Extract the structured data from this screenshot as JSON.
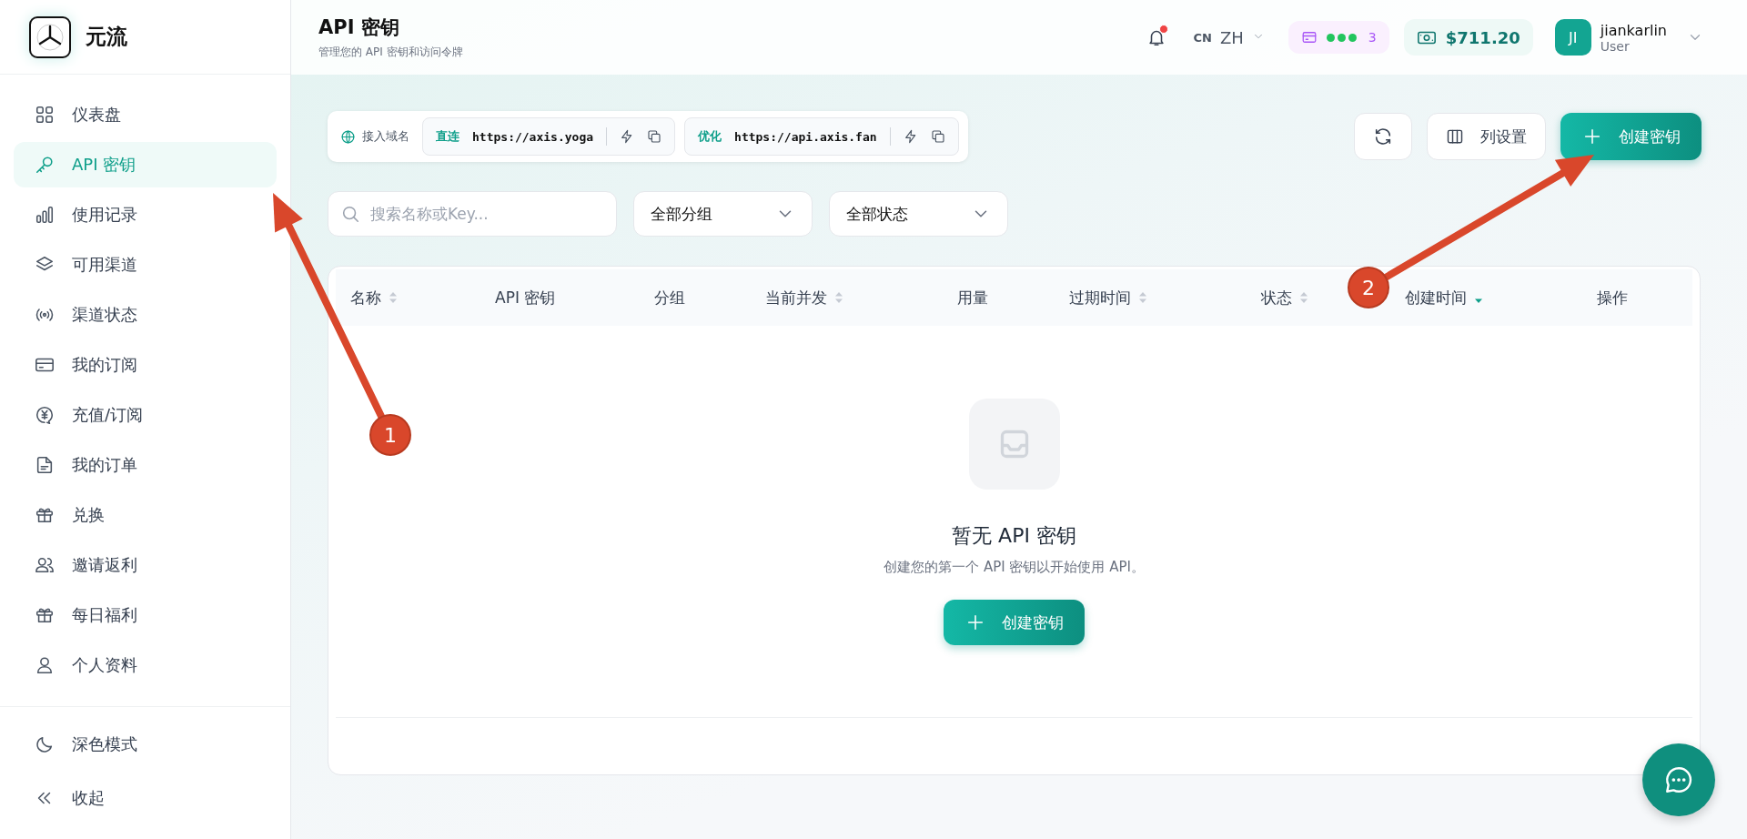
{
  "sidebar": {
    "brand": "元流",
    "items": [
      {
        "label": "仪表盘",
        "selected": false
      },
      {
        "label": "API 密钥",
        "selected": true
      },
      {
        "label": "使用记录",
        "selected": false
      },
      {
        "label": "可用渠道",
        "selected": false
      },
      {
        "label": "渠道状态",
        "selected": false
      },
      {
        "label": "我的订阅",
        "selected": false
      },
      {
        "label": "充值/订阅",
        "selected": false
      },
      {
        "label": "我的订单",
        "selected": false
      },
      {
        "label": "兑换",
        "selected": false
      },
      {
        "label": "邀请返利",
        "selected": false
      },
      {
        "label": "每日福利",
        "selected": false
      },
      {
        "label": "个人资料",
        "selected": false
      }
    ],
    "footer_items": [
      {
        "label": "深色模式"
      },
      {
        "label": "收起"
      }
    ]
  },
  "header": {
    "title": "API 密钥",
    "subtitle": "管理您的 API 密钥和访问令牌",
    "notification_unread": true,
    "language_code": "CN",
    "language": "ZH",
    "plan_count": "3",
    "balance": "$711.20",
    "user": {
      "initials": "JI",
      "name": "jiankarlin",
      "role": "User"
    }
  },
  "domains": {
    "label": "接入域名",
    "entries": [
      {
        "tag": "直连",
        "url": "https://axis.yoga"
      },
      {
        "tag": "优化",
        "url": "https://api.axis.fan"
      }
    ]
  },
  "toolbar": {
    "buttons": [
      {
        "kind": "refresh"
      },
      {
        "kind": "columns",
        "label": "列设置"
      },
      {
        "kind": "create",
        "label": "创建密钥"
      }
    ]
  },
  "filters": {
    "search": {
      "placeholder": "搜索名称或Key..."
    },
    "selects": [
      {
        "value": "全部分组"
      },
      {
        "value": "全部状态"
      }
    ]
  },
  "table": {
    "columns": [
      {
        "label": "名称",
        "sortable": true,
        "sorted_desc": false
      },
      {
        "label": "API 密钥",
        "sortable": false
      },
      {
        "label": "分组",
        "sortable": false
      },
      {
        "label": "当前并发",
        "sortable": true,
        "sorted_desc": false
      },
      {
        "label": "用量",
        "sortable": false
      },
      {
        "label": "过期时间",
        "sortable": true,
        "sorted_desc": false
      },
      {
        "label": "状态",
        "sortable": true,
        "sorted_desc": false
      },
      {
        "label": "创建时间",
        "sortable": true,
        "sorted_desc": true
      },
      {
        "label": "操作",
        "sortable": false
      }
    ],
    "empty_state": {
      "title": "暂无 API 密钥",
      "message": "创建您的第一个 API 密钥以开始使用 API。",
      "button": "创建密钥"
    }
  },
  "annotations": [
    {
      "label": "1"
    },
    {
      "label": "2"
    }
  ]
}
